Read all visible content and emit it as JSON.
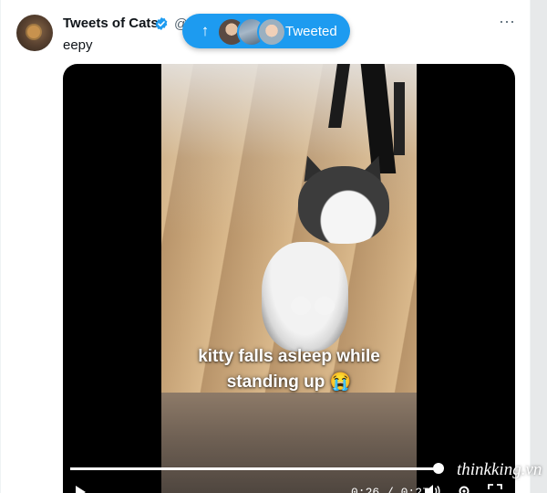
{
  "tweet": {
    "display_name": "Tweets of Cats",
    "handle_prefix": "@",
    "text": "eepy",
    "more_label": "···"
  },
  "toast": {
    "label": "Tweeted",
    "arrow": "↑"
  },
  "video": {
    "caption_line1": "kitty falls asleep while",
    "caption_line2": "standing up 😭",
    "time": "0:26 / 0:27",
    "progress": 0.99
  },
  "watermark": "thinkking.vn",
  "colors": {
    "accent": "#1d9bf0",
    "text_primary": "#0f1419",
    "text_secondary": "#536471"
  },
  "icons": [
    "verified-icon",
    "more-icon",
    "arrow-up-icon",
    "play-icon",
    "volume-icon",
    "gear-icon",
    "fullscreen-icon"
  ]
}
